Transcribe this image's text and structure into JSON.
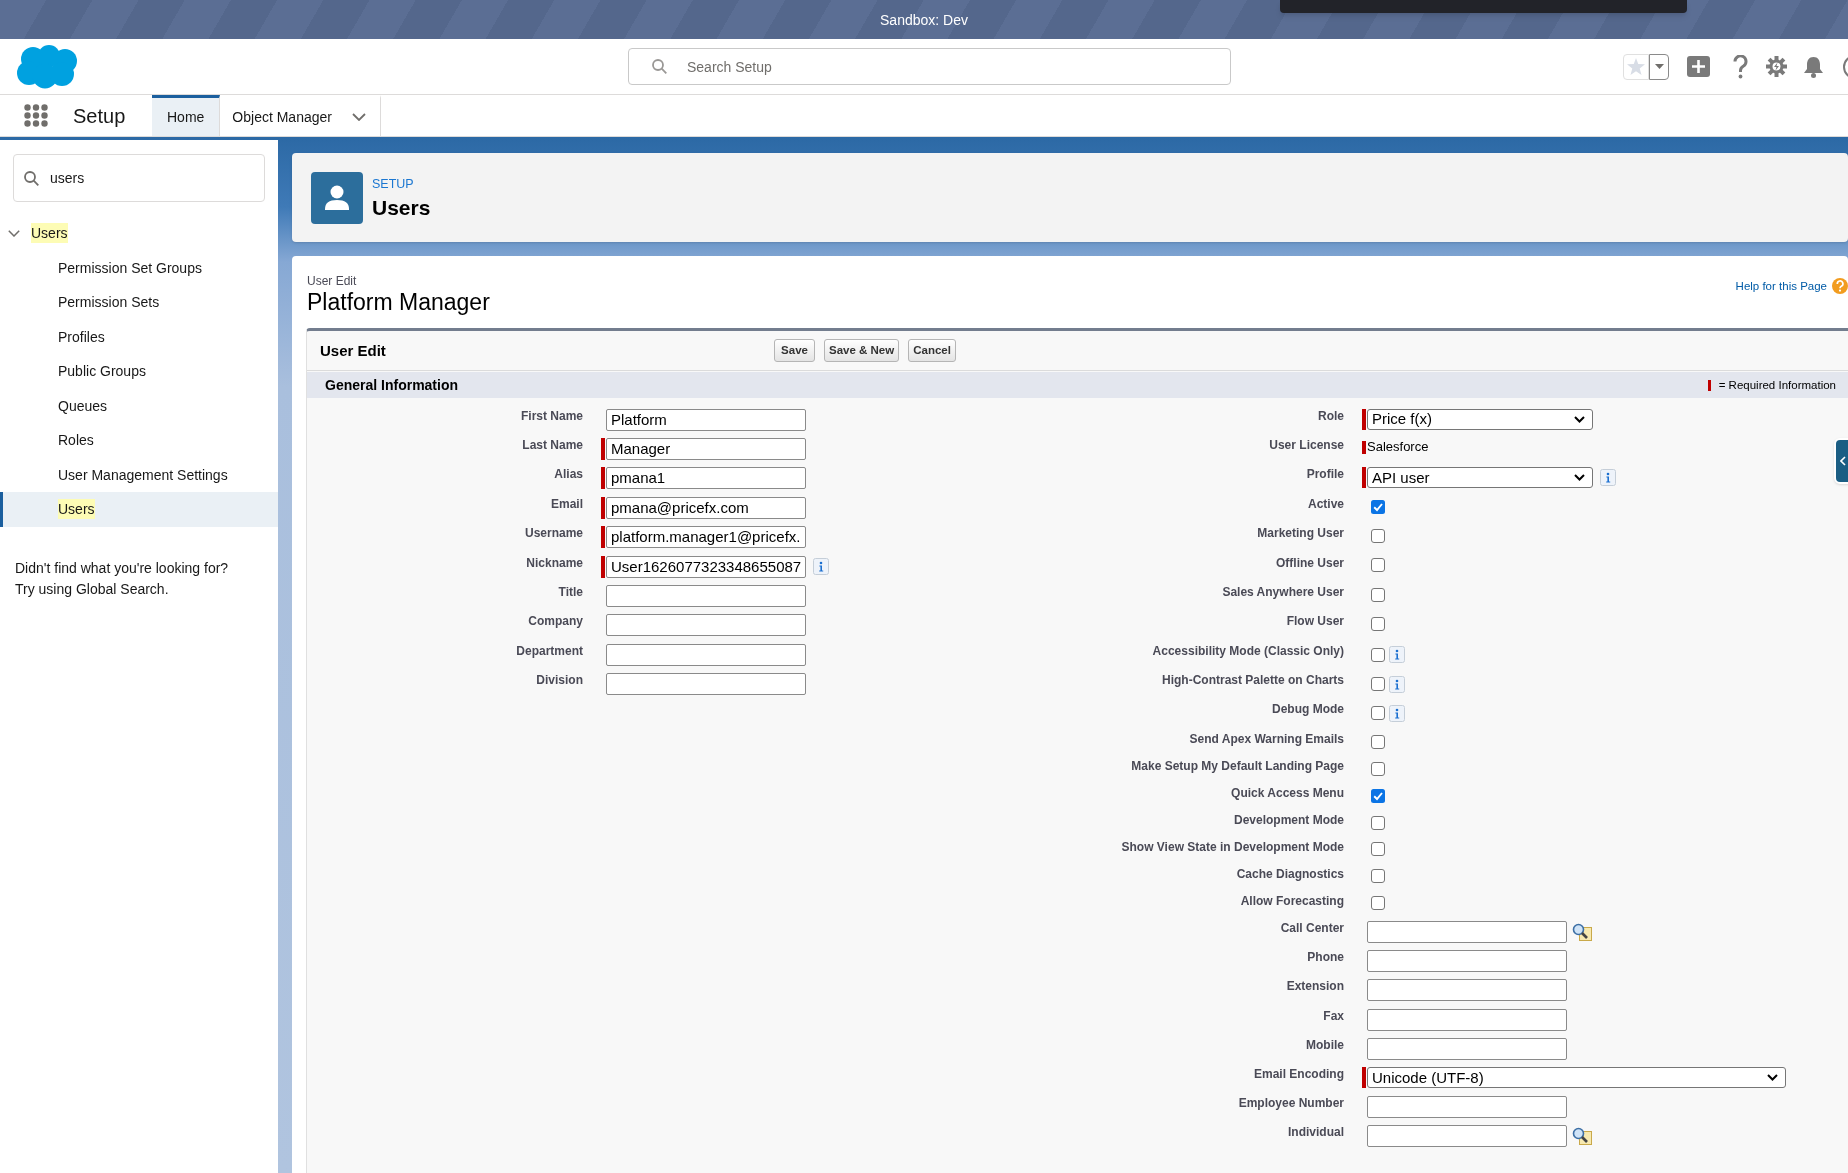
{
  "top_bar": {
    "environment": "Sandbox: Dev"
  },
  "header": {
    "search": {
      "placeholder": "Search Setup"
    }
  },
  "nav": {
    "app_name": "Setup",
    "tabs": [
      {
        "label": "Home",
        "selected": true,
        "menu": false
      },
      {
        "label": "Object Manager",
        "selected": false,
        "menu": true
      }
    ]
  },
  "sidebar": {
    "search": {
      "value": "users"
    },
    "tree": [
      {
        "label": "Users",
        "expanded": true,
        "selected": false,
        "highlighted": true,
        "children": [
          {
            "label": "Permission Set Groups",
            "selected": false,
            "highlighted": false
          },
          {
            "label": "Permission Sets",
            "selected": false,
            "highlighted": false
          },
          {
            "label": "Profiles",
            "selected": false,
            "highlighted": false
          },
          {
            "label": "Public Groups",
            "selected": false,
            "highlighted": false
          },
          {
            "label": "Queues",
            "selected": false,
            "highlighted": false
          },
          {
            "label": "Roles",
            "selected": false,
            "highlighted": false
          },
          {
            "label": "User Management Settings",
            "selected": false,
            "highlighted": false
          },
          {
            "label": "Users",
            "selected": true,
            "highlighted": true
          }
        ]
      }
    ],
    "help_text": [
      "Didn't find what you're looking for?",
      "Try using Global Search."
    ]
  },
  "page_header": {
    "eyebrow": "SETUP",
    "title": "Users"
  },
  "record": {
    "subtitle": "User Edit",
    "title": "Platform Manager",
    "help_link": "Help for this Page"
  },
  "form": {
    "title": "User Edit",
    "buttons": [
      "Save",
      "Save & New",
      "Cancel"
    ],
    "section": {
      "title": "General Information",
      "legend": "= Required Information"
    },
    "left_fields": [
      {
        "label": "First Name",
        "kind": "text",
        "value": "Platform",
        "required": false,
        "info": false
      },
      {
        "label": "Last Name",
        "kind": "text",
        "value": "Manager",
        "required": true,
        "info": false
      },
      {
        "label": "Alias",
        "kind": "text",
        "value": "pmana1",
        "required": true,
        "info": false
      },
      {
        "label": "Email",
        "kind": "text",
        "value": "pmana@pricefx.com",
        "required": true,
        "info": false
      },
      {
        "label": "Username",
        "kind": "text",
        "value": "platform.manager1@pricefx.",
        "required": true,
        "info": false
      },
      {
        "label": "Nickname",
        "kind": "text",
        "value": "User1626077323348655087",
        "required": true,
        "info": true
      },
      {
        "label": "Title",
        "kind": "text",
        "required": false,
        "info": false
      },
      {
        "label": "Company",
        "kind": "text",
        "required": false,
        "info": false
      },
      {
        "label": "Department",
        "kind": "text",
        "required": false,
        "info": false
      },
      {
        "label": "Division",
        "kind": "text",
        "required": false,
        "info": false
      }
    ],
    "right_fields": [
      {
        "label": "Role",
        "kind": "select",
        "value": "Price f(x)",
        "required": true,
        "info": false
      },
      {
        "label": "User License",
        "kind": "static",
        "value": "Salesforce",
        "required": true,
        "info": false
      },
      {
        "label": "Profile",
        "kind": "select",
        "value": "API user",
        "required": true,
        "info": true
      },
      {
        "label": "Active",
        "kind": "checkbox",
        "checked": true,
        "required": false,
        "info": false
      },
      {
        "label": "Marketing User",
        "kind": "checkbox",
        "checked": false,
        "required": false,
        "info": false
      },
      {
        "label": "Offline User",
        "kind": "checkbox",
        "checked": false,
        "required": false,
        "info": false
      },
      {
        "label": "Sales Anywhere User",
        "kind": "checkbox",
        "checked": false,
        "required": false,
        "info": false
      },
      {
        "label": "Flow User",
        "kind": "checkbox",
        "checked": false,
        "required": false,
        "info": false
      },
      {
        "label": "Accessibility Mode (Classic Only)",
        "kind": "checkbox",
        "checked": false,
        "required": false,
        "info": true
      },
      {
        "label": "High-Contrast Palette on Charts",
        "kind": "checkbox",
        "checked": false,
        "required": false,
        "info": true
      },
      {
        "label": "Debug Mode",
        "kind": "checkbox",
        "checked": false,
        "required": false,
        "info": true
      },
      {
        "label": "Send Apex Warning Emails",
        "kind": "checkbox",
        "checked": false,
        "required": false,
        "info": false
      },
      {
        "label": "Make Setup My Default Landing Page",
        "kind": "checkbox",
        "checked": false,
        "required": false,
        "info": false
      },
      {
        "label": "Quick Access Menu",
        "kind": "checkbox",
        "checked": true,
        "required": false,
        "info": false
      },
      {
        "label": "Development Mode",
        "kind": "checkbox",
        "checked": false,
        "required": false,
        "info": false
      },
      {
        "label": "Show View State in Development Mode",
        "kind": "checkbox",
        "checked": false,
        "required": false,
        "info": false
      },
      {
        "label": "Cache Diagnostics",
        "kind": "checkbox",
        "checked": false,
        "required": false,
        "info": false
      },
      {
        "label": "Allow Forecasting",
        "kind": "checkbox",
        "checked": false,
        "required": false,
        "info": false
      },
      {
        "label": "Call Center",
        "kind": "lookup",
        "required": false,
        "info": false
      },
      {
        "label": "Phone",
        "kind": "text",
        "required": false,
        "info": false
      },
      {
        "label": "Extension",
        "kind": "text",
        "required": false,
        "info": false
      },
      {
        "label": "Fax",
        "kind": "text",
        "required": false,
        "info": false
      },
      {
        "label": "Mobile",
        "kind": "text",
        "required": false,
        "info": false
      },
      {
        "label": "Email Encoding",
        "kind": "wideselect",
        "value": "Unicode (UTF-8)",
        "required": true,
        "info": false
      },
      {
        "label": "Employee Number",
        "kind": "text",
        "required": false,
        "info": false
      },
      {
        "label": "Individual",
        "kind": "lookup",
        "required": false,
        "info": false
      }
    ]
  }
}
